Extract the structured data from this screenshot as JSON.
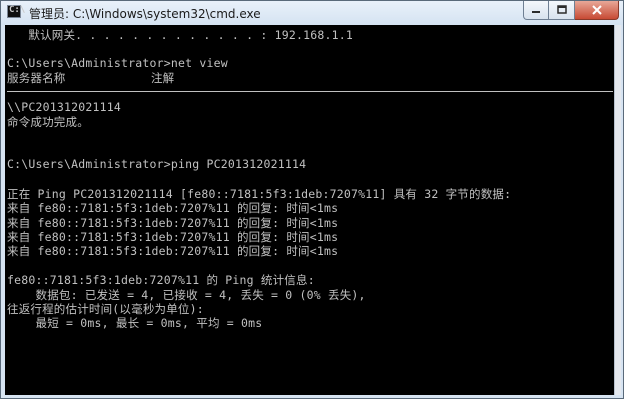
{
  "window": {
    "title": "管理员: C:\\Windows\\system32\\cmd.exe",
    "icon": "cmd-window-icon",
    "buttons": {
      "minimize": "minimize-icon",
      "maximize": "maximize-icon",
      "close": "close-icon"
    }
  },
  "console": {
    "lines": [
      "   默认网关. . . . . . . . . . . . . : 192.168.1.1",
      "",
      "C:\\Users\\Administrator>net view",
      "服务器名称            注解",
      "",
      "\\\\PC201312021114",
      "命令成功完成。",
      "",
      "",
      "C:\\Users\\Administrator>ping PC201312021114",
      "",
      "正在 Ping PC201312021114 [fe80::7181:5f3:1deb:7207%11] 具有 32 字节的数据:",
      "来自 fe80::7181:5f3:1deb:7207%11 的回复: 时间<1ms",
      "来自 fe80::7181:5f3:1deb:7207%11 的回复: 时间<1ms",
      "来自 fe80::7181:5f3:1deb:7207%11 的回复: 时间<1ms",
      "来自 fe80::7181:5f3:1deb:7207%11 的回复: 时间<1ms",
      "",
      "fe80::7181:5f3:1deb:7207%11 的 Ping 统计信息:",
      "    数据包: 已发送 = 4, 已接收 = 4, 丢失 = 0 (0% 丢失),",
      "往返行程的估计时间(以毫秒为单位):",
      "    最短 = 0ms, 最长 = 0ms, 平均 = 0ms"
    ]
  },
  "colors": {
    "console_bg": "#000000",
    "console_fg": "#c0c0c0",
    "close_button": "#c74a34"
  }
}
